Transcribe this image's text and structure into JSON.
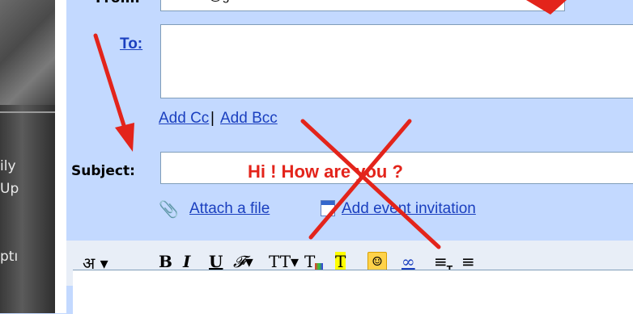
{
  "left_panel": {
    "text_lines": [
      "ily",
      "Up",
      "ptı"
    ]
  },
  "compose": {
    "from_label": "From:",
    "from_value": "... ........@gmail.com",
    "to_label": "To:",
    "add_cc": "Add Cc",
    "separator": "|",
    "add_bcc": "Add Bcc",
    "subject_label": "Subject:",
    "subject_value": "Hi ! How are you ?",
    "attach_file": "Attach a file",
    "add_event": "Add event invitation"
  },
  "toolbar": {
    "items": [
      {
        "name": "hindi-input-button",
        "label": "अ ▾"
      },
      {
        "name": "bold-button",
        "label": "B"
      },
      {
        "name": "italic-button",
        "label": "I"
      },
      {
        "name": "underline-button",
        "label": "U"
      },
      {
        "name": "font-button",
        "label": "𝓕▾"
      },
      {
        "name": "font-size-button",
        "label": "TT▾"
      },
      {
        "name": "text-color-button",
        "label": "T"
      },
      {
        "name": "highlight-button",
        "label": "T"
      },
      {
        "name": "emoticon-button",
        "label": "☺"
      },
      {
        "name": "link-button",
        "label": "∞"
      },
      {
        "name": "numbered-list-button",
        "label": "≡"
      },
      {
        "name": "bullet-list-button",
        "label": "≡"
      }
    ]
  },
  "colors": {
    "compose_bg": "#c3d9ff",
    "link": "#1a3fbf",
    "annotation_red": "#e3241b"
  }
}
